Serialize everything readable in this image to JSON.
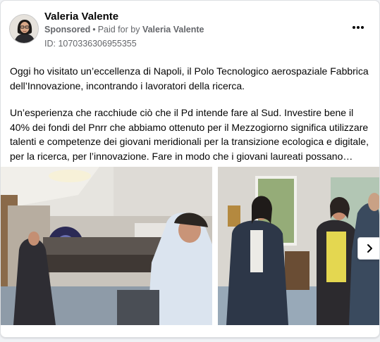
{
  "post": {
    "author_name": "Valeria Valente",
    "sponsored_label": "Sponsored",
    "separator": "•",
    "paid_prefix": "Paid for by",
    "paid_by": "Valeria Valente",
    "library_id": "ID: 1070336306955355",
    "paragraph_1": "Oggi ho visitato un’eccellenza di Napoli, il Polo Tecnologico aerospaziale Fabbrica dell’Innovazione, incontrando i lavoratori della ricerca.",
    "paragraph_2": "Un’esperienza che racchiude ciò che il Pd intende fare al Sud. Investire bene il 40% dei fondi del Pnrr che abbiamo ottenuto per il Mezzogiorno significa utilizzare talenti e competenze dei giovani meridionali per la transizione ecologica e digitale, per la ricerca, per l’innovazione. Fare in modo che i giovani laureati possano…"
  },
  "icons": {
    "more": "more-options-icon",
    "next": "chevron-right-icon"
  },
  "colors": {
    "text_primary": "#050505",
    "text_secondary": "#65676b",
    "card_background": "#ffffff",
    "page_background": "#f0f2f5"
  }
}
